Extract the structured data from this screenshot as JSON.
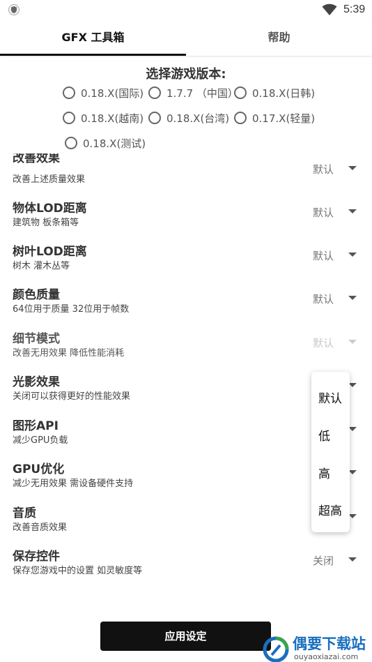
{
  "status": {
    "time": "5:39",
    "left_icon": "shield-icon",
    "right_icon": "wifi-icon"
  },
  "tabs": [
    {
      "label": "GFX 工具箱"
    },
    {
      "label": "帮助"
    }
  ],
  "version": {
    "title": "选择游戏版本:",
    "options": [
      "0.18.X(国际)",
      "1.7.7 （中国）",
      "0.18.X(日韩)",
      "0.18.X(越南)",
      "0.18.X(台湾)",
      "0.17.X(轻量)",
      "0.18.X(测试)"
    ]
  },
  "settings": [
    {
      "title": "改善效果",
      "subtitle": "改善上述质量效果",
      "value": "默认"
    },
    {
      "title": "物体LOD距离",
      "subtitle": "建筑物 板条箱等",
      "value": "默认"
    },
    {
      "title": "树叶LOD距离",
      "subtitle": "树木 灌木丛等",
      "value": "默认"
    },
    {
      "title": "颜色质量",
      "subtitle": "64位用于质量 32位用于帧数",
      "value": "默认"
    },
    {
      "title": "细节模式",
      "subtitle": "改善无用效果 降低性能消耗",
      "value": "默认"
    },
    {
      "title": "光影效果",
      "subtitle": "关闭可以获得更好的性能效果",
      "value": ""
    },
    {
      "title": "图形API",
      "subtitle": "减少GPU负载",
      "value": ""
    },
    {
      "title": "GPU优化",
      "subtitle": "减少无用效果 需设备硬件支持",
      "value": ""
    },
    {
      "title": "音质",
      "subtitle": "改善音质效果",
      "value": ""
    },
    {
      "title": "保存控件",
      "subtitle": "保存您游戏中的设置 如灵敏度等",
      "value": "关闭"
    }
  ],
  "dropdown": {
    "options": [
      "默认",
      "低",
      "高",
      "超高"
    ]
  },
  "apply_label": "应用设定",
  "watermark": {
    "brand": "偶要下载站",
    "url": "ouyaoxiazai.com"
  }
}
